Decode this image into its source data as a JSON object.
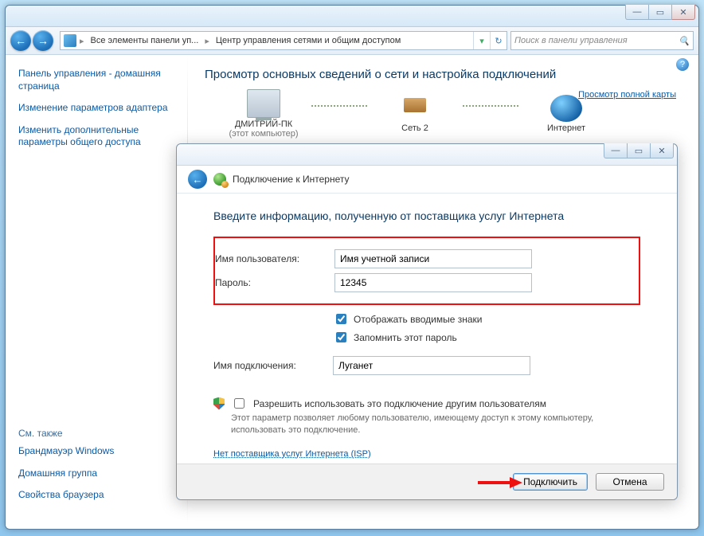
{
  "window": {
    "breadcrumb1": "Все элементы панели уп...",
    "breadcrumb2": "Центр управления сетями и общим доступом",
    "search_placeholder": "Поиск в панели управления"
  },
  "sidebar": {
    "home": "Панель управления - домашняя страница",
    "adapter": "Изменение параметров адаптера",
    "sharing": "Изменить дополнительные параметры общего доступа",
    "see_also": "См. также",
    "firewall": "Брандмауэр Windows",
    "homegroup": "Домашняя группа",
    "browser_props": "Свойства браузера"
  },
  "content": {
    "title": "Просмотр основных сведений о сети и настройка подключений",
    "full_map": "Просмотр полной карты",
    "node_pc": "ДМИТРИЙ-ПК",
    "node_pc_sub": "(этот компьютер)",
    "node_net": "Сеть 2",
    "node_inet": "Интернет"
  },
  "dialog": {
    "header": "Подключение к Интернету",
    "heading": "Введите информацию, полученную от поставщика услуг Интернета",
    "lbl_user": "Имя пользователя:",
    "val_user": "Имя учетной записи",
    "lbl_pass": "Пароль:",
    "val_pass": "12345",
    "chk_show": "Отображать вводимые знаки",
    "chk_remember": "Запомнить этот пароль",
    "lbl_conn": "Имя подключения:",
    "val_conn": "Луганет",
    "perm_label": "Разрешить использовать это подключение другим пользователям",
    "perm_hint": "Этот параметр позволяет любому пользователю, имеющему доступ к этому компьютеру, использовать это подключение.",
    "isp_link": "Нет поставщика услуг Интернета (ISP)",
    "btn_connect": "Подключить",
    "btn_cancel": "Отмена"
  }
}
